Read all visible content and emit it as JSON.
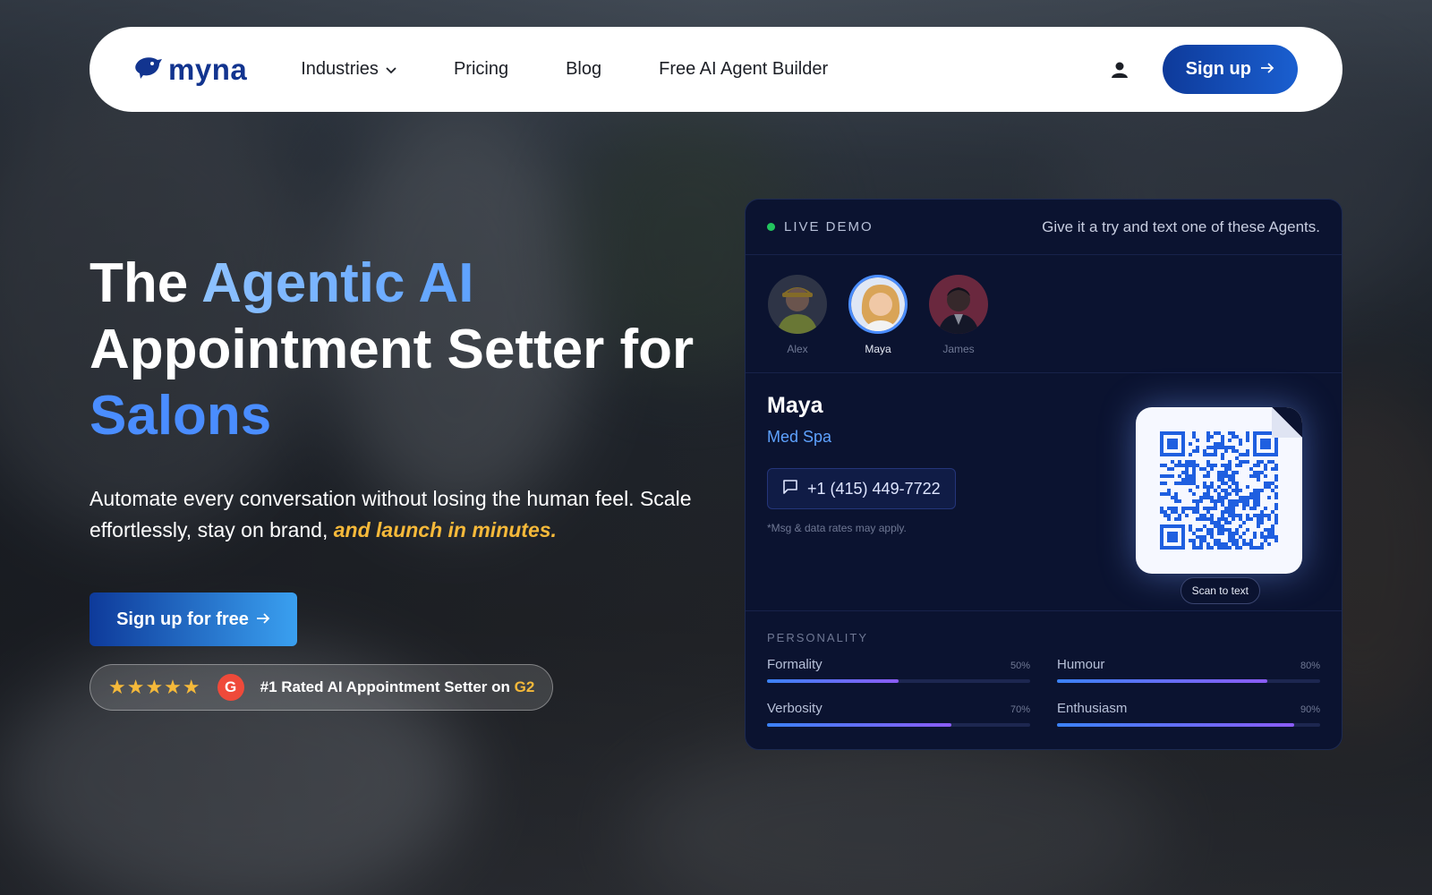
{
  "brand": {
    "name": "myna",
    "color": "#12348f"
  },
  "nav": {
    "items": [
      {
        "label": "Industries",
        "has_dropdown": true
      },
      {
        "label": "Pricing"
      },
      {
        "label": "Blog"
      },
      {
        "label": "Free AI Agent Builder"
      }
    ],
    "signup_label": "Sign up"
  },
  "hero": {
    "title_part1": "The ",
    "title_accent": "Agentic AI",
    "title_part2": "Appointment Setter for",
    "title_industry": "Salons",
    "subtitle_main": "Automate every conversation without losing the human feel. Scale effortlessly, stay on brand, ",
    "subtitle_highlight": "and launch in minutes.",
    "cta_label": "Sign up for free",
    "rating_stars": "★★★★★",
    "rating_badge": "G",
    "rating_text": "#1 Rated AI Appointment Setter on ",
    "rating_brand": "G2"
  },
  "demo": {
    "live_label": "LIVE DEMO",
    "tagline": "Give it a try and text one of these Agents.",
    "agents": [
      {
        "name": "Alex",
        "selected": false
      },
      {
        "name": "Maya",
        "selected": true
      },
      {
        "name": "James",
        "selected": false
      }
    ],
    "selected_agent": {
      "name": "Maya",
      "role": "Med Spa",
      "phone": "+1 (415) 449-7722",
      "fine_print": "*Msg & data rates may apply."
    },
    "scan_label": "Scan to text",
    "personality_title": "PERSONALITY",
    "traits": [
      {
        "name": "Formality",
        "value_label": "50%",
        "value": 0.5
      },
      {
        "name": "Humour",
        "value_label": "80%",
        "value": 0.8
      },
      {
        "name": "Verbosity",
        "value_label": "70%",
        "value": 0.7
      },
      {
        "name": "Enthusiasm",
        "value_label": "90%",
        "value": 0.9
      }
    ]
  },
  "colors": {
    "accent_blue": "#4a8dff",
    "highlight_orange": "#f5b93a",
    "panel_bg": "#0b1330",
    "live_green": "#22c55e"
  }
}
